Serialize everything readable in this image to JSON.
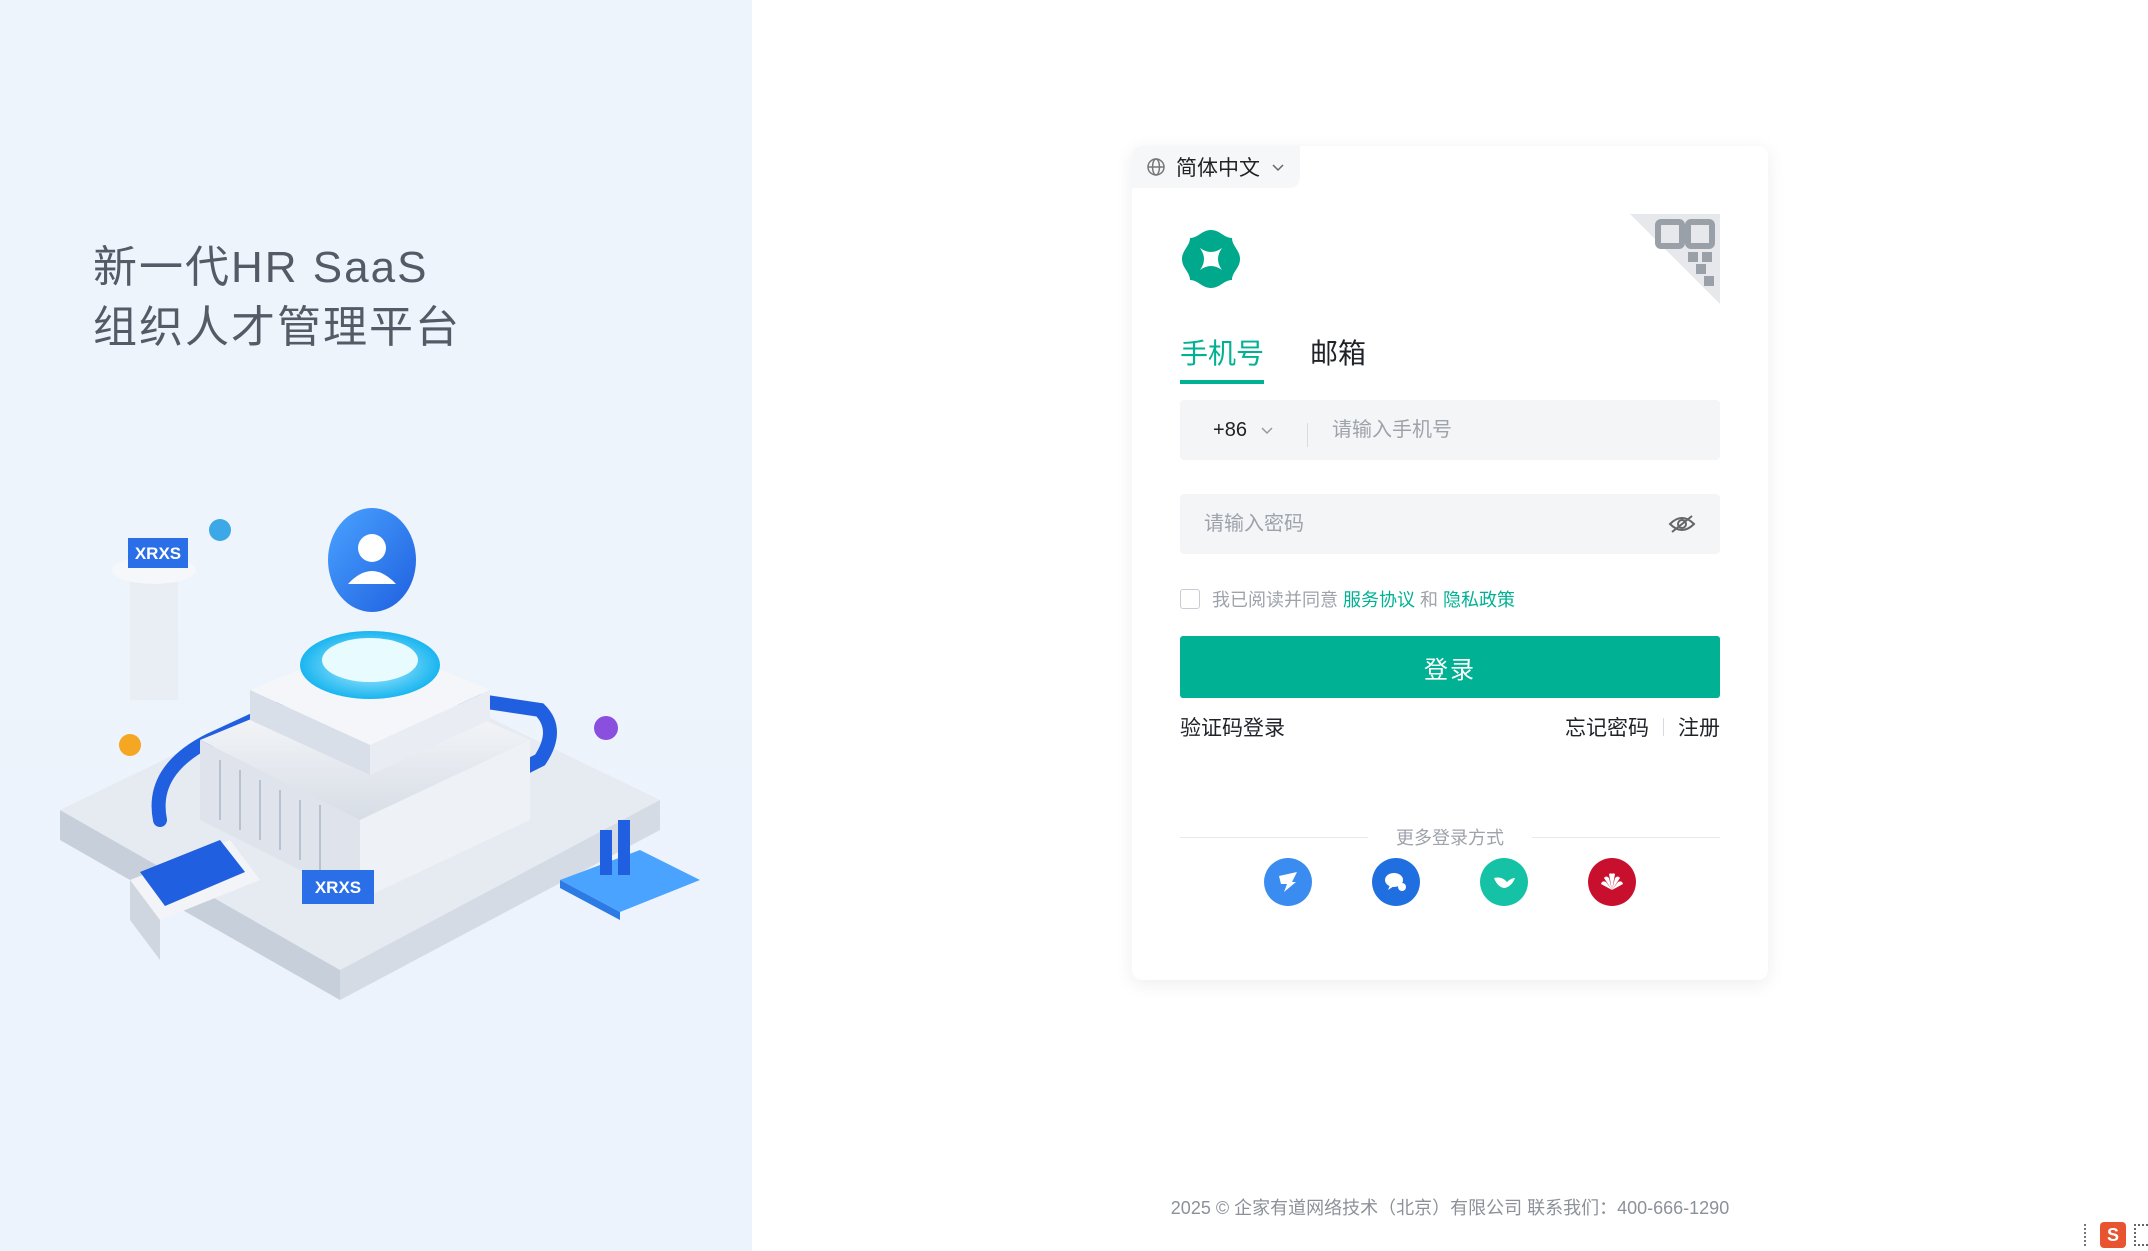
{
  "left": {
    "slogan_line1": "新一代HR SaaS",
    "slogan_line2": "组织人才管理平台",
    "illustration": {
      "sign_top": "XRXS",
      "sign_bottom": "XRXS"
    }
  },
  "login_card": {
    "language": "简体中文",
    "tabs": [
      {
        "label": "手机号",
        "active": true
      },
      {
        "label": "邮箱",
        "active": false
      }
    ],
    "country_code": "+86",
    "phone_placeholder": "请输入手机号",
    "password_placeholder": "请输入密码",
    "agreement": {
      "prefix": "我已阅读并同意",
      "service_link": "服务协议",
      "and": "和",
      "privacy_link": "隐私政策"
    },
    "login_button": "登录",
    "code_login": "验证码登录",
    "forgot_password": "忘记密码",
    "register": "注册",
    "more_methods": "更多登录方式",
    "social_icons": [
      "dingtalk-icon",
      "wecom-icon",
      "feishu-icon",
      "huawei-icon"
    ]
  },
  "footer": {
    "text": "2025 © 企家有道网络技术（北京）有限公司 联系我们：400-666-1290"
  },
  "colors": {
    "accent": "#00b293",
    "left_bg": "#eef4fc"
  }
}
